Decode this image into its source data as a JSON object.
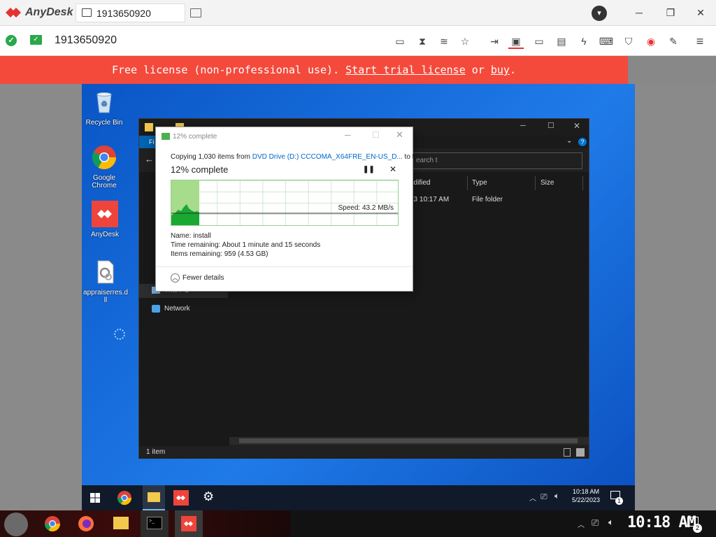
{
  "anydesk": {
    "brand": "AnyDesk",
    "tab_label": "1913650920",
    "address": "1913650920",
    "colors": {
      "banner": "#f34a3c",
      "brand_red": "#e3342f",
      "ok_green": "#2aa84a"
    },
    "toolbar_icons": [
      "hidden-screen-icon",
      "hourglass-icon",
      "database-icon",
      "star-icon",
      "transfer-icon",
      "monitor-switch-icon",
      "display-icon",
      "chat-icon",
      "actions-icon",
      "keyboard-icon",
      "privacy-icon",
      "record-icon",
      "whiteboard-icon",
      "hamburger-menu-icon"
    ]
  },
  "banner": {
    "prefix": "Free license (non-professional use). ",
    "trial_link": "Start trial license",
    "middle": " or ",
    "buy_link": "buy",
    "suffix": "."
  },
  "desktop": {
    "icons": [
      {
        "label": "Recycle Bin"
      },
      {
        "label": "Google Chrome"
      },
      {
        "label": "AnyDesk"
      },
      {
        "label": "appraiserres.dll"
      }
    ]
  },
  "explorer": {
    "ribbon_file": "Fi",
    "search_placeholder": "earch t",
    "columns": {
      "modified": "odified",
      "type": "Type",
      "size": "Size"
    },
    "row": {
      "modified": "23 10:17 AM",
      "type": "File folder"
    },
    "sidebar": {
      "this_pc": "This PC",
      "network": "Network"
    },
    "status": "1 item"
  },
  "copy_dialog": {
    "title": "12% complete",
    "subtitle_prefix": "Copying 1,030 items from ",
    "source": "DVD Drive (D:) CCCOMA_X64FRE_EN-US_D...",
    "subtitle_suffix": " to t",
    "percent_label": "12% complete",
    "progress": 0.12,
    "speed": "Speed: 43.2 MB/s",
    "name_line": "Name:  install",
    "time_line": "Time remaining:  About 1 minute and 15 seconds",
    "items_line": "Items remaining:  959 (4.53 GB)",
    "fewer_details": "Fewer details"
  },
  "remote_taskbar": {
    "time": "10:18 AM",
    "date": "5/22/2023",
    "notif_count": "1"
  },
  "local_taskbar": {
    "clock": "10:18 AM",
    "notif_count": "2"
  }
}
